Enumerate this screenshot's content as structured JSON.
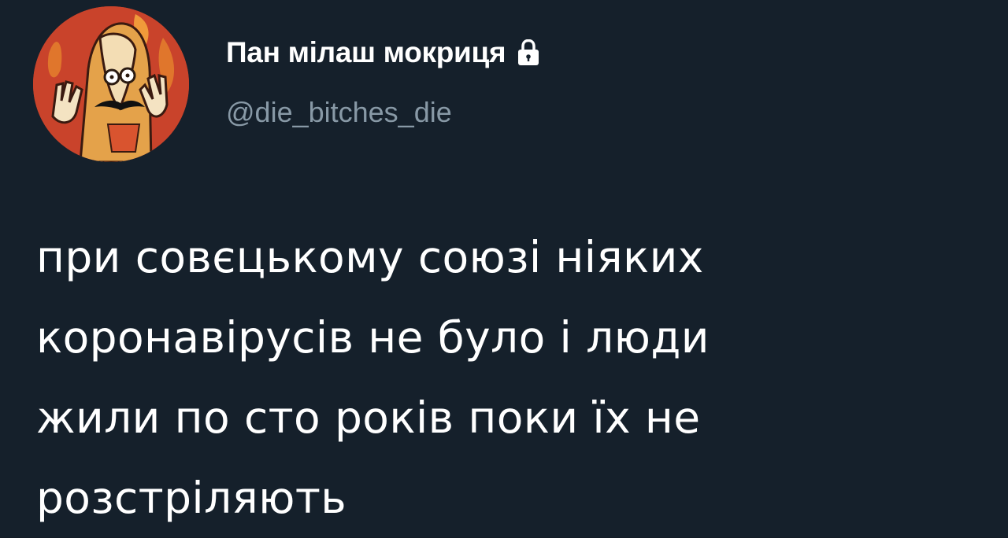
{
  "author": {
    "display_name": "Пан мілаш мокриця",
    "handle": "@die_bitches_die",
    "protected_icon": "lock-icon",
    "avatar_icon": "cartoon-character-avatar"
  },
  "tweet": {
    "lines": [
      "при совєцькому союзі ніяких",
      "коронавірусів не було і люди",
      "жили по сто років поки їх не",
      "розстріляють"
    ]
  },
  "colors": {
    "background": "#15202b",
    "text": "#ffffff",
    "handle": "#8899a6",
    "avatar_bg": "#c8442a"
  }
}
